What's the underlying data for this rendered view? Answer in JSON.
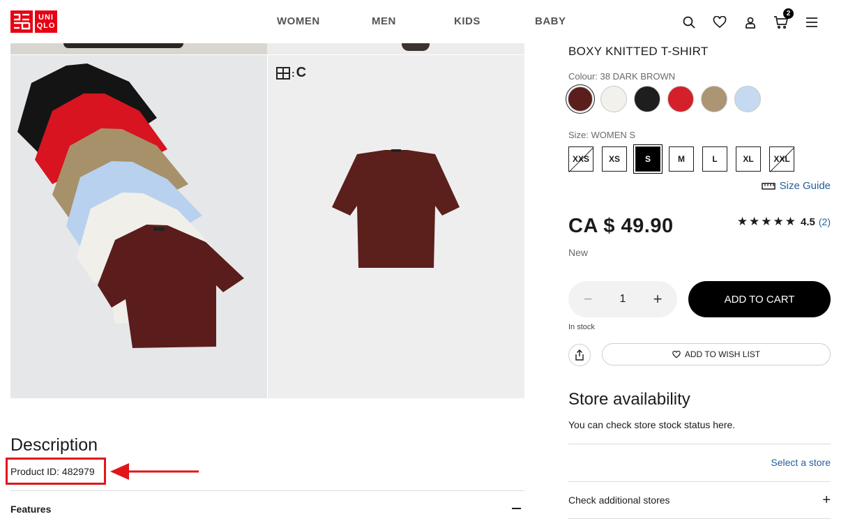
{
  "header": {
    "logo": {
      "top": "UNI",
      "bottom": "QLO"
    },
    "nav": [
      "WOMEN",
      "MEN",
      "KIDS",
      "BABY"
    ],
    "cart_count": "2"
  },
  "product": {
    "name": "BOXY KNITTED T-SHIRT",
    "colour_label": "Colour: 38 DARK BROWN",
    "colours": [
      "#5a1f1c",
      "#f3f1ec",
      "#1e1e1e",
      "#d3202a",
      "#ab9572",
      "#c5d9f1"
    ],
    "size_label": "Size: WOMEN S",
    "sizes": [
      {
        "label": "XXS",
        "state": "unavailable"
      },
      {
        "label": "XS",
        "state": "available"
      },
      {
        "label": "S",
        "state": "selected"
      },
      {
        "label": "M",
        "state": "available"
      },
      {
        "label": "L",
        "state": "available"
      },
      {
        "label": "XL",
        "state": "available"
      },
      {
        "label": "XXL",
        "state": "unavailable"
      }
    ],
    "size_guide": "Size Guide",
    "price": "CA $ 49.90",
    "rating_stars": "★★★★★",
    "rating_value": "4.5",
    "rating_count": "(2)",
    "tag": "New",
    "quantity": "1",
    "add_to_cart": "ADD TO CART",
    "stock_status": "In stock",
    "wish_list": "ADD TO WISH LIST"
  },
  "gallery": {
    "image_badge": "C"
  },
  "store": {
    "title": "Store availability",
    "subtitle": "You can check store stock status here.",
    "select_store": "Select a store",
    "check_additional": "Check additional stores"
  },
  "description": {
    "title": "Description",
    "product_id": "Product ID: 482979",
    "features": "Features"
  }
}
